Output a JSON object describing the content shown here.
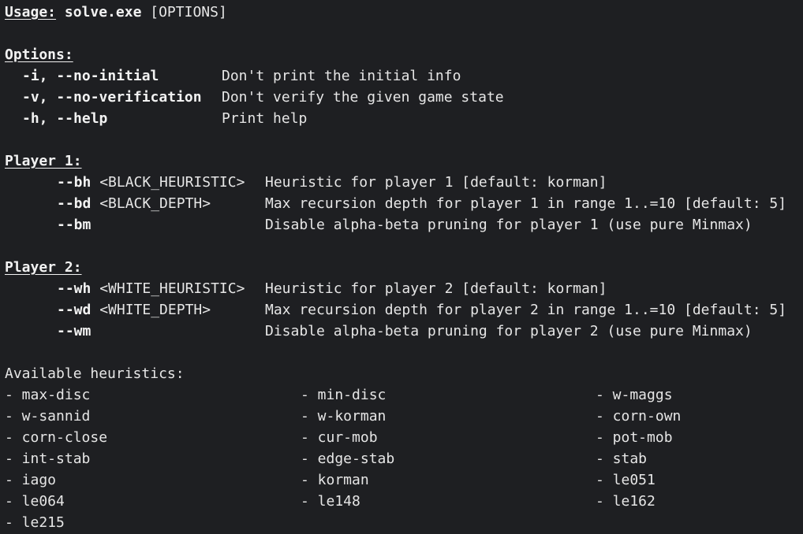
{
  "usage": {
    "label": "Usage:",
    "command": "solve.exe",
    "args": " [OPTIONS]"
  },
  "options": {
    "heading": "Options:",
    "items": [
      {
        "flags": "-i, --no-initial",
        "desc": "Don't print the initial info"
      },
      {
        "flags": "-v, --no-verification",
        "desc": "Don't verify the given game state"
      },
      {
        "flags": "-h, --help",
        "desc": "Print help"
      }
    ]
  },
  "player1": {
    "heading": "Player 1:",
    "items": [
      {
        "flag": "--bh",
        "value": " <BLACK_HEURISTIC>",
        "desc": "Heuristic for player 1 [default: korman]"
      },
      {
        "flag": "--bd",
        "value": " <BLACK_DEPTH>",
        "desc": "Max recursion depth for player 1 in range 1..=10 [default: 5]"
      },
      {
        "flag": "--bm",
        "value": "",
        "desc": "Disable alpha-beta pruning for player 1 (use pure Minmax)"
      }
    ]
  },
  "player2": {
    "heading": "Player 2:",
    "items": [
      {
        "flag": "--wh",
        "value": " <WHITE_HEURISTIC>",
        "desc": "Heuristic for player 2 [default: korman]"
      },
      {
        "flag": "--wd",
        "value": " <WHITE_DEPTH>",
        "desc": "Max recursion depth for player 2 in range 1..=10 [default: 5]"
      },
      {
        "flag": "--wm",
        "value": "",
        "desc": "Disable alpha-beta pruning for player 2 (use pure Minmax)"
      }
    ]
  },
  "heuristics": {
    "heading": "Available heuristics:",
    "rows": [
      [
        "- max-disc",
        "- min-disc",
        "- w-maggs"
      ],
      [
        "- w-sannid",
        "- w-korman",
        "- corn-own"
      ],
      [
        "- corn-close",
        "- cur-mob",
        "- pot-mob"
      ],
      [
        "- int-stab",
        "- edge-stab",
        "- stab"
      ],
      [
        "- iago",
        "- korman",
        "- le051"
      ],
      [
        "- le064",
        "- le148",
        "- le162"
      ],
      [
        "- le215",
        "",
        ""
      ]
    ]
  }
}
